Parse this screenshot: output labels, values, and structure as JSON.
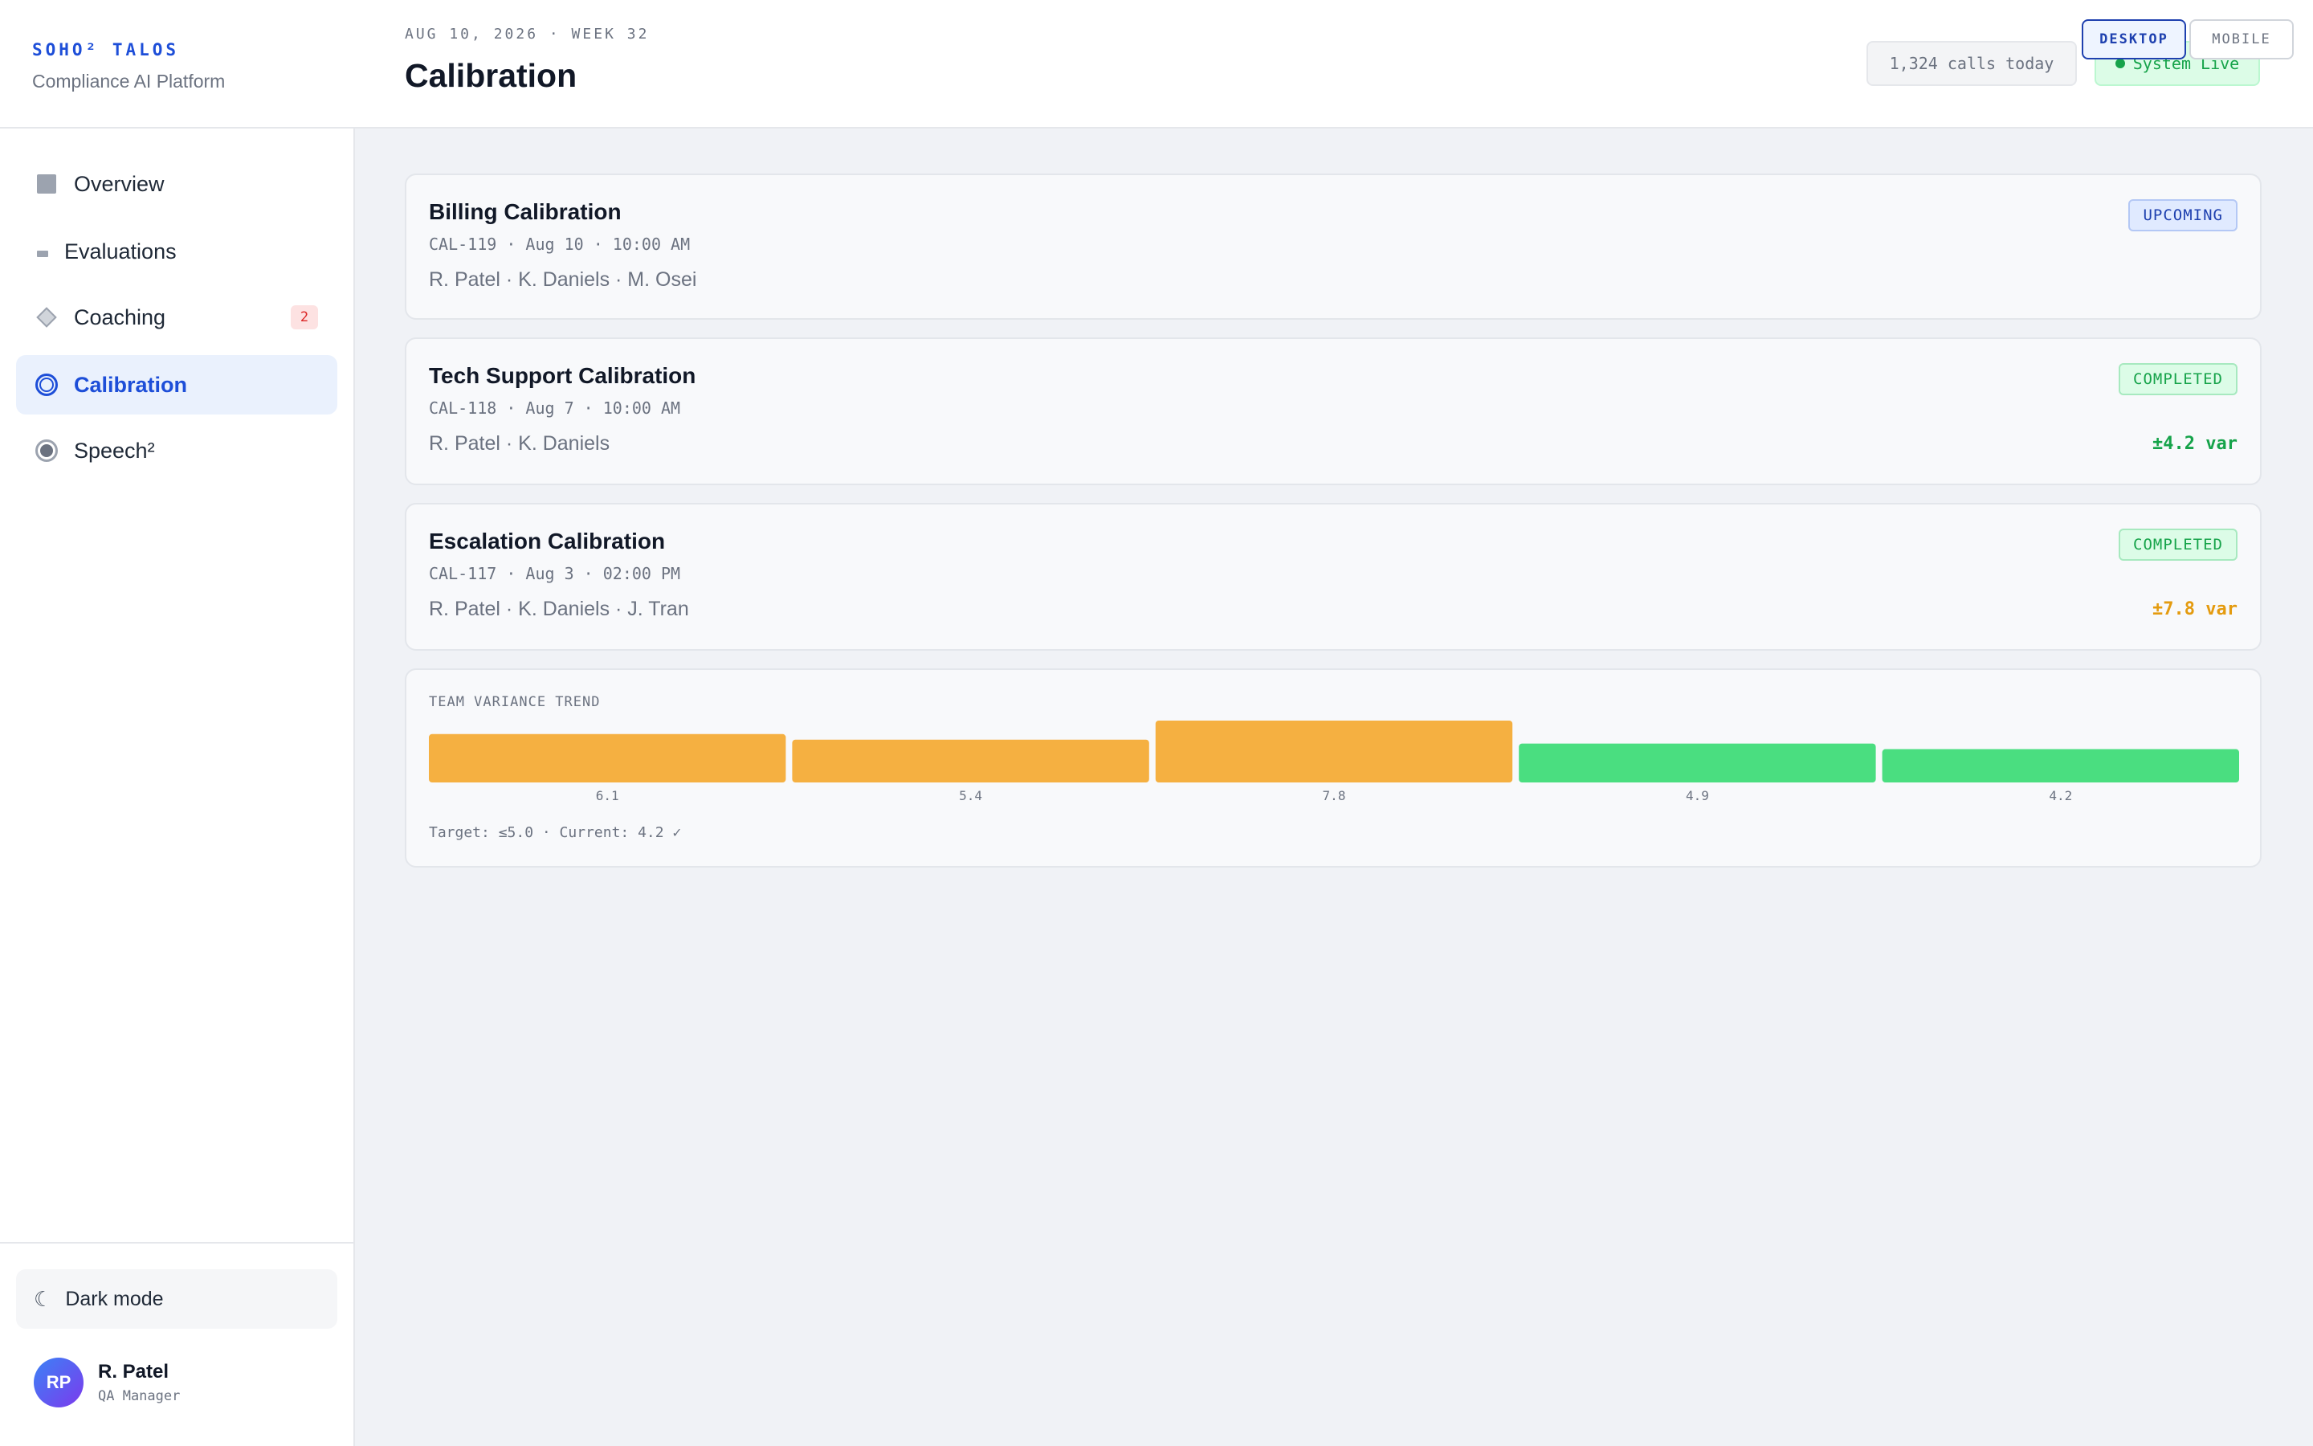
{
  "brand": {
    "name": "SOHO² TALOS",
    "subtitle": "Compliance AI Platform"
  },
  "header": {
    "date": "AUG 10, 2026 · WEEK 32",
    "title": "Calibration",
    "calls_today": "1,324 calls today",
    "system_status": "System Live",
    "view_toggle": {
      "desktop": "DESKTOP",
      "mobile": "MOBILE",
      "active": "desktop"
    }
  },
  "sidebar": {
    "items": [
      {
        "label": "Overview",
        "icon": "grid-square-icon"
      },
      {
        "label": "Evaluations",
        "icon": "bars-icon"
      },
      {
        "label": "Coaching",
        "icon": "diamond-icon",
        "badge": "2"
      },
      {
        "label": "Calibration",
        "icon": "target-icon",
        "active": true
      },
      {
        "label": "Speech²",
        "icon": "speech-circle-icon"
      }
    ],
    "dark_mode_label": "Dark mode",
    "user": {
      "initials": "RP",
      "name": "R. Patel",
      "role": "QA Manager"
    }
  },
  "sessions": [
    {
      "title": "Billing Calibration",
      "meta": "CAL-119 · Aug 10 · 10:00 AM",
      "participants": "R. Patel · K. Daniels · M. Osei",
      "status": "UPCOMING",
      "variance": ""
    },
    {
      "title": "Tech Support Calibration",
      "meta": "CAL-118 · Aug 7 · 10:00 AM",
      "participants": "R. Patel · K. Daniels",
      "status": "COMPLETED",
      "variance": "±4.2 var",
      "variance_color": "#16a34a"
    },
    {
      "title": "Escalation Calibration",
      "meta": "CAL-117 · Aug 3 · 02:00 PM",
      "participants": "R. Patel · K. Daniels · J. Tran",
      "status": "COMPLETED",
      "variance": "±7.8 var",
      "variance_color": "#e49b0f"
    }
  ],
  "trend": {
    "title": "TEAM VARIANCE TREND",
    "note": "Target: ≤5.0 · Current: 4.2 ✓"
  },
  "chart_data": {
    "type": "bar",
    "title": "TEAM VARIANCE TREND",
    "values": [
      6.1,
      5.4,
      7.8,
      4.9,
      4.2
    ],
    "value_labels": [
      "6.1",
      "5.4",
      "7.8",
      "4.9",
      "4.2"
    ],
    "target": 5.0,
    "colors": {
      "above_target": "#f5b041",
      "within_target": "#4ade80"
    },
    "grid": false
  }
}
